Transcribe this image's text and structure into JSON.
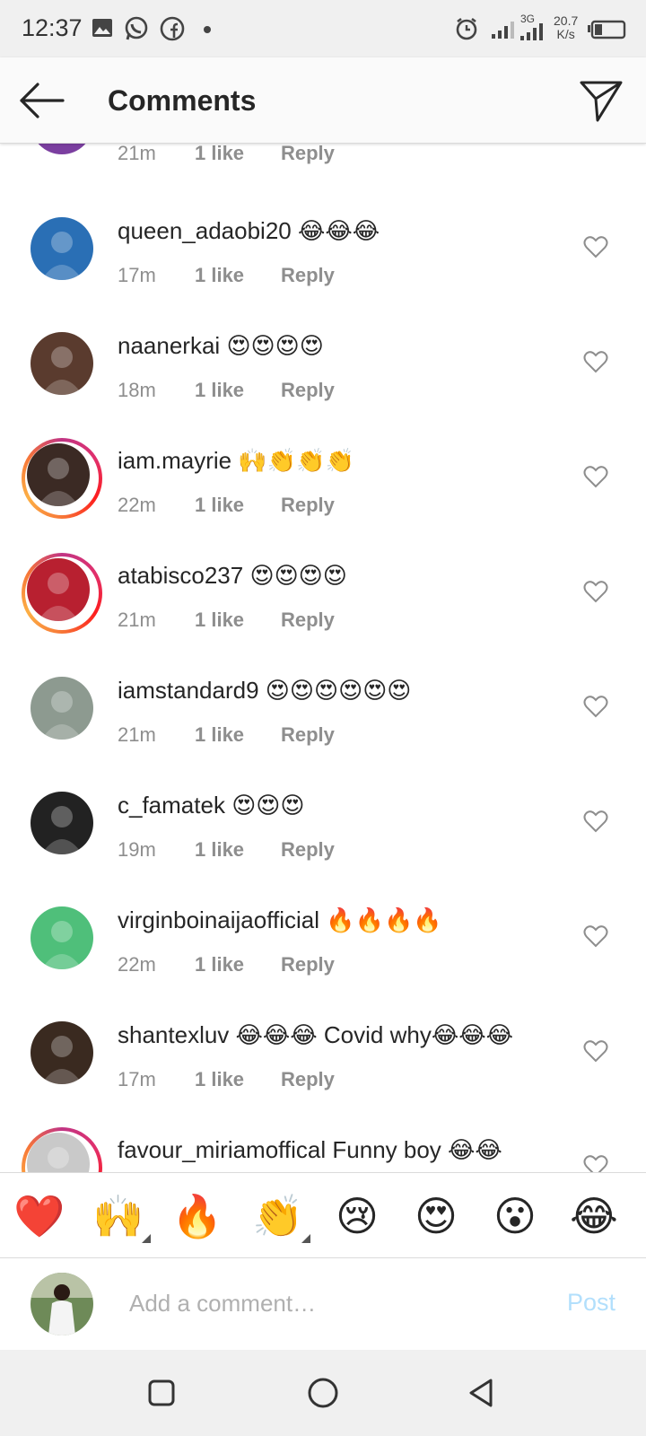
{
  "status_bar": {
    "time": "12:37",
    "speed_value": "20.7",
    "speed_unit": "K/s",
    "network_label": "3G"
  },
  "header": {
    "title": "Comments"
  },
  "partial_top": {
    "time": "21m",
    "likes": "1 like",
    "reply": "Reply"
  },
  "comments": [
    {
      "username": "queen_adaobi20",
      "text": "😂😂😂",
      "time": "17m",
      "likes": "1 like",
      "reply": "Reply",
      "story_ring": false,
      "avatar_color": "#2a6fb5"
    },
    {
      "username": "naanerkai",
      "text": "😍😍😍😍",
      "time": "18m",
      "likes": "1 like",
      "reply": "Reply",
      "story_ring": false,
      "avatar_color": "#5a3b2e"
    },
    {
      "username": "iam.mayrie",
      "text": "🙌👏👏👏",
      "time": "22m",
      "likes": "1 like",
      "reply": "Reply",
      "story_ring": true,
      "avatar_color": "#3b2a24"
    },
    {
      "username": "atabisco237",
      "text": "😍😍😍😍",
      "time": "21m",
      "likes": "1 like",
      "reply": "Reply",
      "story_ring": true,
      "avatar_color": "#b82030"
    },
    {
      "username": "iamstandard9",
      "text": "😍😍😍😍😍😍",
      "time": "21m",
      "likes": "1 like",
      "reply": "Reply",
      "story_ring": false,
      "avatar_color": "#8d9a90"
    },
    {
      "username": "c_famatek",
      "text": "😍😍😍",
      "time": "19m",
      "likes": "1 like",
      "reply": "Reply",
      "story_ring": false,
      "avatar_color": "#222222"
    },
    {
      "username": "virginboinaijaofficial",
      "text": "🔥🔥🔥🔥",
      "time": "22m",
      "likes": "1 like",
      "reply": "Reply",
      "story_ring": false,
      "avatar_color": "#4fbf7a"
    },
    {
      "username": "shantexluv",
      "text": "😂😂😂 Covid why😂😂😂",
      "time": "17m",
      "likes": "1 like",
      "reply": "Reply",
      "story_ring": false,
      "avatar_color": "#3a2a20"
    },
    {
      "username": "favour_miriamoffical",
      "text": "Funny boy 😂😂",
      "time": "",
      "likes": "",
      "reply": "",
      "story_ring": true,
      "avatar_color": "#c9c9c9"
    }
  ],
  "emoji_bar": [
    {
      "emoji": "❤️",
      "has_variants": false
    },
    {
      "emoji": "🙌",
      "has_variants": true
    },
    {
      "emoji": "🔥",
      "has_variants": false
    },
    {
      "emoji": "👏",
      "has_variants": true
    },
    {
      "emoji": "😢",
      "has_variants": false
    },
    {
      "emoji": "😍",
      "has_variants": false
    },
    {
      "emoji": "😮",
      "has_variants": false
    },
    {
      "emoji": "😂",
      "has_variants": false
    }
  ],
  "composer": {
    "placeholder": "Add a comment…",
    "post_label": "Post"
  },
  "nav": {
    "icons": [
      "recents-square-icon",
      "home-circle-icon",
      "back-triangle-icon"
    ]
  }
}
